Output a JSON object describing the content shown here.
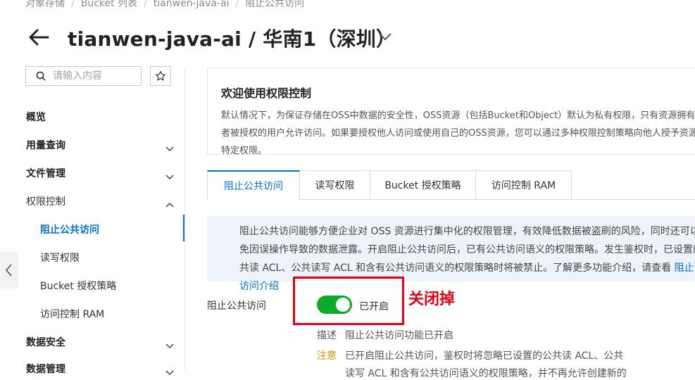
{
  "breadcrumb": [
    "对象存储",
    "Bucket 列表",
    "tianwen-java-ai",
    "阻止公共访问"
  ],
  "header": {
    "title": "tianwen-java-ai / 华南1（深圳）"
  },
  "sidebar": {
    "search_placeholder": "请输入内容",
    "items": [
      {
        "label": "概览"
      },
      {
        "label": "用量查询"
      },
      {
        "label": "文件管理"
      },
      {
        "label": "权限控制"
      },
      {
        "label": "阻止公共访问"
      },
      {
        "label": "读写权限"
      },
      {
        "label": "Bucket 授权策略"
      },
      {
        "label": "访问控制 RAM"
      },
      {
        "label": "数据安全"
      },
      {
        "label": "数据管理"
      }
    ]
  },
  "welcome": {
    "title": "欢迎使用权限控制",
    "desc": "默认情况下，为保证存储在OSS中数据的安全性，OSS资源（包括Bucket和Object）默认为私有权限，只有资源拥有者或者被授权的用户允许访问。如果要授权他人访问或使用自己的OSS资源，您可以通过多种权限控制策略向他人授予资源的特定权限。"
  },
  "tabs": [
    {
      "label": "阻止公共访问"
    },
    {
      "label": "读写权限"
    },
    {
      "label": "Bucket 授权策略"
    },
    {
      "label": "访问控制 RAM"
    }
  ],
  "info": {
    "text": "阻止公共访问能够方便企业对 OSS 资源进行集中化的权限管理，有效降低数据被盗刷的风险，同时还可以避免因误操作导致的数据泄露。开启阻止公共访问后，已有公共访问语义的权限策略。发生鉴权时，已设置的公共读 ACL、公共读写 ACL 和含有公共访问语义的权限策略时将被禁止。了解更多功能介绍，请查看 ",
    "link": "阻止公共访问介绍"
  },
  "setting": {
    "label": "阻止公共访问",
    "status": "已开启",
    "enabled": true,
    "annotation": "关闭掉",
    "desc_label": "描述",
    "desc_value": "阻止公共访问功能已开启",
    "note_label": "注意",
    "note_value": "已开启阻止公共访问，鉴权时将忽略已设置的公共读 ACL、公共",
    "note_next": "读写 ACL 和含有公共访问语义的权限策略，并不再允许创建新的"
  },
  "colors": {
    "accent": "#0070cc",
    "toggle_on": "#0dab2c",
    "annotation": "#e60012",
    "warning": "#e58a00"
  }
}
